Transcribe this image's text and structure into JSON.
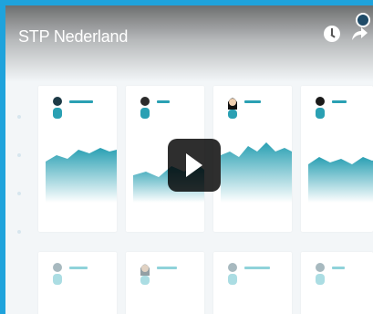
{
  "video": {
    "title": "STP Nederland",
    "icons": {
      "clock": "clock-icon",
      "share": "share-icon",
      "status": "status-dot",
      "play": "play-icon"
    }
  },
  "dashboard": {
    "top_row_cards": [
      {
        "id": "card-1",
        "kind": "person",
        "line_width": 0.44
      },
      {
        "id": "card-2",
        "kind": "person",
        "line_width": 0.2
      },
      {
        "id": "card-3",
        "kind": "person",
        "line_width": 0.28
      },
      {
        "id": "card-4",
        "kind": "person",
        "line_width": 0.22
      }
    ],
    "bottom_row_cards": [
      {
        "id": "card-5",
        "kind": "person"
      },
      {
        "id": "card-6",
        "kind": "person"
      },
      {
        "id": "card-7",
        "kind": "person"
      },
      {
        "id": "card-8",
        "kind": "person"
      }
    ],
    "colors": {
      "teal": "#2aa0b3",
      "teal_light": "#8fd2da",
      "background": "#f3f6f8",
      "frame": "#1fa3dc"
    }
  }
}
